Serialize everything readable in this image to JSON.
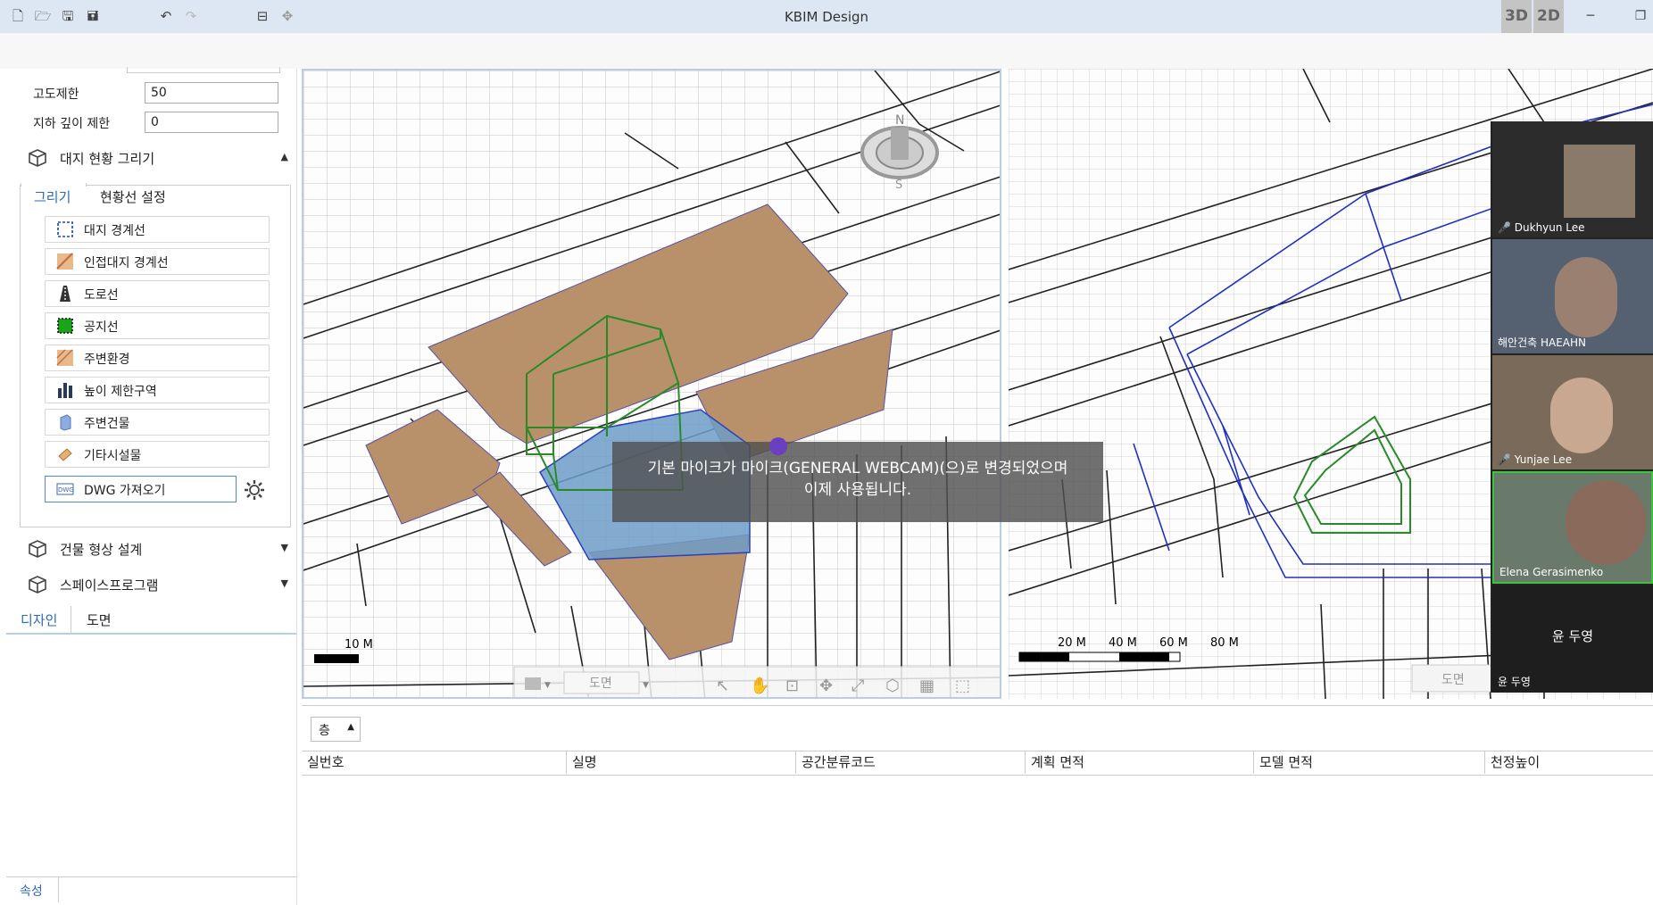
{
  "app": {
    "title": "KBIM Design"
  },
  "titlebar": {
    "mode_3d": "3D",
    "mode_2d": "2D",
    "minimize": "─",
    "restore": "❐"
  },
  "site_limits": {
    "height_limit_label": "고도제한",
    "height_limit_value": "50",
    "depth_limit_label": "지하 깊이 제한",
    "depth_limit_value": "0"
  },
  "site_drawing": {
    "title": "대지 현황 그리기",
    "tabs": [
      "그리기",
      "현황선 설정"
    ],
    "tools": [
      {
        "label": "대지 경계선",
        "icon": "site-boundary-icon"
      },
      {
        "label": "인접대지 경계선",
        "icon": "adjacent-site-icon"
      },
      {
        "label": "도로선",
        "icon": "road-icon"
      },
      {
        "label": "공지선",
        "icon": "open-space-icon"
      },
      {
        "label": "주변환경",
        "icon": "environment-icon"
      },
      {
        "label": "높이 제한구역",
        "icon": "height-zone-icon"
      },
      {
        "label": "주변건물",
        "icon": "building-icon"
      },
      {
        "label": "기타시설물",
        "icon": "facility-icon"
      }
    ],
    "dwg_import": "DWG 가져오기"
  },
  "sections": {
    "building_design": "건물 형상 설계",
    "space_program": "스페이스프로그램"
  },
  "panel_tabs": {
    "design": "디자인",
    "drawing": "도면"
  },
  "properties_tab": "속성",
  "viewport_left": {
    "scale": "10 M",
    "toolbar_sheet": "도면"
  },
  "viewport_right": {
    "scales": [
      "20 M",
      "40 M",
      "60 M",
      "80 M"
    ],
    "toolbar_sheet": "도면"
  },
  "toast": {
    "line1": "기본 마이크가 마이크(GENERAL WEBCAM)(으)로 변경되었으며",
    "line2": "이제 사용됩니다."
  },
  "bottom": {
    "floor_label": "층",
    "columns": [
      "실번호",
      "실명",
      "공간분류코드",
      "계획 면적",
      "모델 면적",
      "천정높이"
    ]
  },
  "participants": [
    {
      "name": "Dukhyun Lee",
      "muted": true
    },
    {
      "name": "해안건축 HAEAHN",
      "muted": false
    },
    {
      "name": "Yunjae Lee",
      "muted": true
    },
    {
      "name": "Elena Gerasimenko",
      "muted": false
    },
    {
      "name": "윤 두영",
      "muted": false,
      "center_name": "윤 두영"
    }
  ],
  "colors": {
    "titlebar": "#dde7f4",
    "site_fill": "#b8916a",
    "highlight_blue": "#6d9cc7",
    "accent": "#2a6ab8"
  }
}
